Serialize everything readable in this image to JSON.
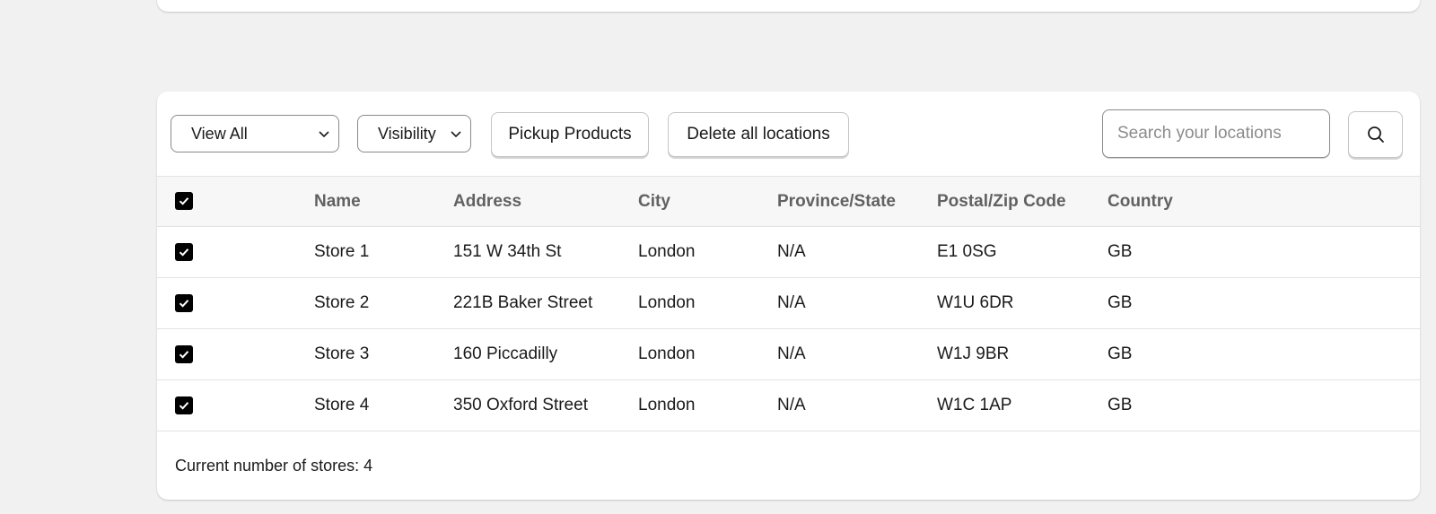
{
  "toolbar": {
    "view_filter": {
      "selected": "View All"
    },
    "visibility_filter": {
      "selected": "Visibility"
    },
    "pickup_products_label": "Pickup Products",
    "delete_all_label": "Delete all locations",
    "search": {
      "placeholder": "Search your locations",
      "value": ""
    }
  },
  "table": {
    "columns": [
      "Name",
      "Address",
      "City",
      "Province/State",
      "Postal/Zip Code",
      "Country"
    ],
    "select_all_checked": true,
    "rows": [
      {
        "checked": true,
        "name": "Store 1",
        "address": "151 W 34th St",
        "city": "London",
        "province": "N/A",
        "postal": "E1 0SG",
        "country": "GB"
      },
      {
        "checked": true,
        "name": "Store 2",
        "address": "221B Baker Street",
        "city": "London",
        "province": "N/A",
        "postal": "W1U 6DR",
        "country": "GB"
      },
      {
        "checked": true,
        "name": "Store 3",
        "address": "160 Piccadilly",
        "city": "London",
        "province": "N/A",
        "postal": "W1J 9BR",
        "country": "GB"
      },
      {
        "checked": true,
        "name": "Store 4",
        "address": "350 Oxford Street",
        "city": "London",
        "province": "N/A",
        "postal": "W1C 1AP",
        "country": "GB"
      }
    ]
  },
  "footer": {
    "store_count_text": "Current number of stores: 4"
  },
  "colors": {
    "page_bg": "#f1f1f1",
    "checkbox": "#000000",
    "header_text": "#616161"
  },
  "icons": {
    "search": "search-icon",
    "dropdown": "chevron-down-icon",
    "checkbox": "checkmark-icon"
  }
}
